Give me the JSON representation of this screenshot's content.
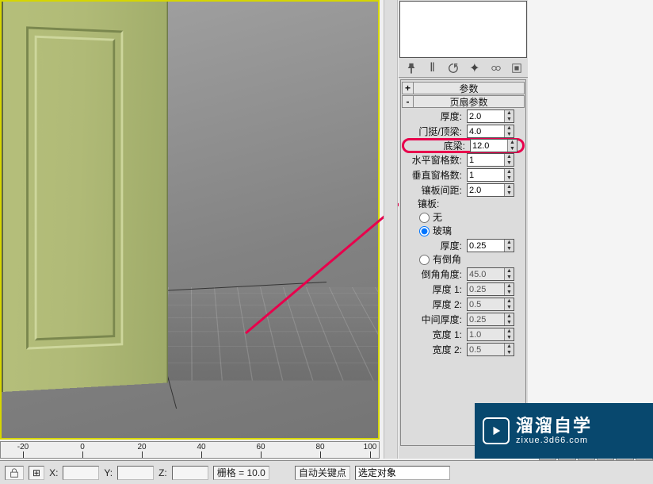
{
  "ruler": {
    "ticks": [
      "-20",
      "0",
      "20",
      "40",
      "60",
      "80",
      "100"
    ]
  },
  "panel_icons": {
    "pin": "pin-icon",
    "divider": "|",
    "h": "history-icon",
    "fav": "favorite-icon",
    "bind": "bind-icon",
    "cfg": "config-icon"
  },
  "rollouts": {
    "params": {
      "pm": "+",
      "title": "参数"
    },
    "leaf": {
      "pm": "-",
      "title": "页扇参数",
      "rows": {
        "thickness": {
          "label": "厚度:",
          "value": "2.0"
        },
        "stile": {
          "label": "门挺/顶梁:",
          "value": "4.0"
        },
        "bottom": {
          "label": "底梁:",
          "value": "12.0"
        },
        "hcount": {
          "label": "水平窗格数:",
          "value": "1"
        },
        "vcount": {
          "label": "垂直窗格数:",
          "value": "1"
        },
        "spacing": {
          "label": "镶板间距:",
          "value": "2.0"
        }
      },
      "panel_section": "镶板:",
      "radios": {
        "none": "无",
        "glass": "玻璃",
        "bevel": "有倒角"
      },
      "glass_thickness": {
        "label": "厚度:",
        "value": "0.25"
      },
      "bevel_params": {
        "angle": {
          "label": "倒角角度:",
          "value": "45.0"
        },
        "t1": {
          "label": "厚度 1:",
          "value": "0.25"
        },
        "t2": {
          "label": "厚度 2:",
          "value": "0.5"
        },
        "mid": {
          "label": "中间厚度:",
          "value": "0.25"
        },
        "w1": {
          "label": "宽度 1:",
          "value": "1.0"
        },
        "w2": {
          "label": "宽度 2:",
          "value": "0.5"
        }
      }
    }
  },
  "status": {
    "x": "X:",
    "y": "Y:",
    "z": "Z:",
    "grid_label": "栅格",
    "grid_value": "= 10.0",
    "autokey": "自动关键点",
    "selection": "选定对象"
  },
  "transport": {
    "b1": "|◀◀",
    "b2": "◀◀",
    "b3": "▶",
    "b4": "▶▶",
    "b5": "▶▶|",
    "b6": "◉"
  },
  "watermark": {
    "title": "溜溜自学",
    "sub": "zixue.3d66.com"
  },
  "chart_data": null
}
